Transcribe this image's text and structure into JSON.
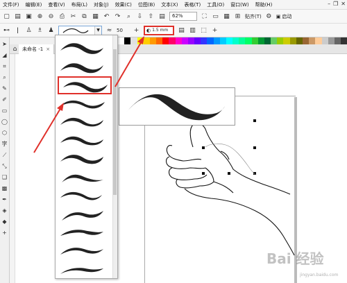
{
  "menu": {
    "items": [
      "文件(F)",
      "编辑(E)",
      "查看(V)",
      "布局(L)",
      "对象(J)",
      "效果(C)",
      "位图(B)",
      "文本(X)",
      "表格(T)",
      "工具(O)",
      "窗口(W)",
      "帮助(H)"
    ]
  },
  "toolbar": {
    "zoom": "62%",
    "snap_label": "贴齐(T)",
    "launch_label": "启动"
  },
  "propbar": {
    "smoothing": "50",
    "stroke_width": "1.5 mm"
  },
  "document": {
    "tab_title": "未命名 -1"
  },
  "palette": {
    "colors": [
      "#ffffff",
      "#000000",
      "#e0e0e0",
      "#ffff00",
      "#ffcc00",
      "#ff9900",
      "#ff6600",
      "#ff0000",
      "#ff0066",
      "#ff00cc",
      "#cc00ff",
      "#9900ff",
      "#6600ff",
      "#3333ff",
      "#0066ff",
      "#0099ff",
      "#00ccff",
      "#00ffff",
      "#00ffcc",
      "#00ff99",
      "#00ff66",
      "#33cc33",
      "#009933",
      "#006633",
      "#66cc66",
      "#99cc00",
      "#cccc00",
      "#999900",
      "#666600",
      "#996633",
      "#cc9966",
      "#ffcc99",
      "#cccccc",
      "#999999",
      "#666666",
      "#333333"
    ]
  },
  "strokes": {
    "count": 13,
    "selected_index": 2
  },
  "watermark": {
    "text": "Bai 经验",
    "sub": "jingyan.baidu.com"
  }
}
